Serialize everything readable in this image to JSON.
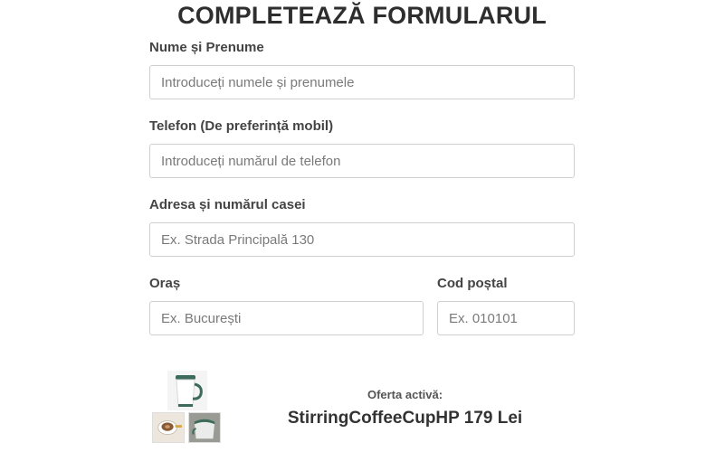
{
  "form": {
    "title": "COMPLETEAZĂ FORMULARUL",
    "name": {
      "label": "Nume și Prenume",
      "placeholder": "Introduceți numele și prenumele"
    },
    "phone": {
      "label": "Telefon (De preferință mobil)",
      "placeholder": "Introduceți numărul de telefon"
    },
    "address": {
      "label": "Adresa și numărul casei",
      "placeholder": "Ex. Strada Principală 130"
    },
    "city": {
      "label": "Oraș",
      "placeholder": "Ex. București"
    },
    "postal": {
      "label": "Cod poștal",
      "placeholder": "Ex. 010101"
    }
  },
  "offer": {
    "label": "Oferta activă:",
    "product": "StirringCoffeeCupHP 179 Lei"
  },
  "colors": {
    "accent": "#3d6b5a",
    "border": "#cfcfcf"
  }
}
